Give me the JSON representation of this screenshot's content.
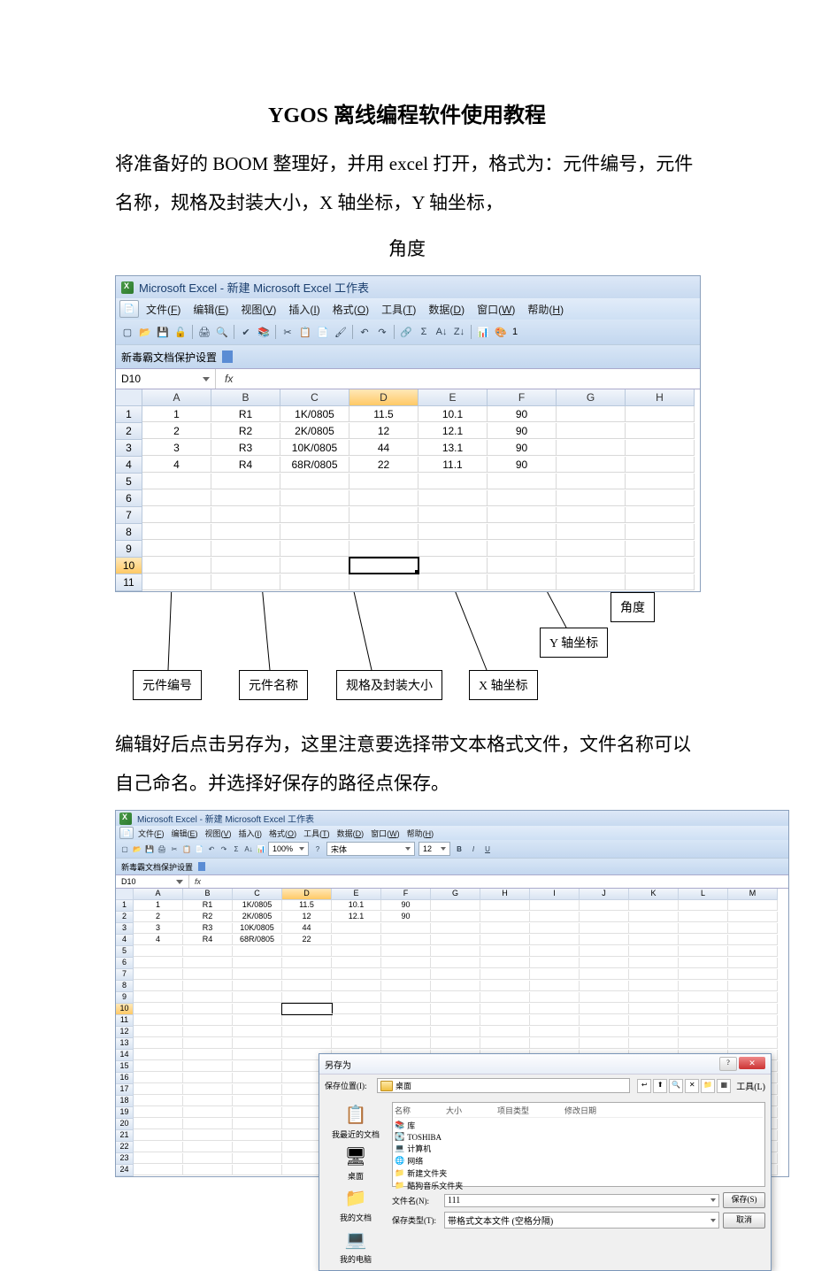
{
  "doc": {
    "title": "YGOS 离线编程软件使用教程",
    "p1": "将准备好的 BOOM 整理好，并用 excel 打开，格式为：元件编号，元件名称，规格及封装大小，X 轴坐标，Y 轴坐标，",
    "p1b": "角度",
    "p2": "编辑好后点击另存为，这里注意要选择带文本格式文件，文件名称可以自己命名。并选择好保存的路径点保存。"
  },
  "excel1": {
    "title": "Microsoft Excel - 新建 Microsoft Excel 工作表",
    "menus": [
      {
        "label": "文件",
        "key": "F"
      },
      {
        "label": "编辑",
        "key": "E"
      },
      {
        "label": "视图",
        "key": "V"
      },
      {
        "label": "插入",
        "key": "I"
      },
      {
        "label": "格式",
        "key": "O"
      },
      {
        "label": "工具",
        "key": "T"
      },
      {
        "label": "数据",
        "key": "D"
      },
      {
        "label": "窗口",
        "key": "W"
      },
      {
        "label": "帮助",
        "key": "H"
      }
    ],
    "protect": "新毒霸文档保护设置",
    "name_box": "D10",
    "columns": [
      "A",
      "B",
      "C",
      "D",
      "E",
      "F",
      "G",
      "H"
    ],
    "rows": [
      [
        "1",
        "R1",
        "1K/0805",
        "11.5",
        "10.1",
        "90",
        "",
        ""
      ],
      [
        "2",
        "R2",
        "2K/0805",
        "12",
        "12.1",
        "90",
        "",
        ""
      ],
      [
        "3",
        "R3",
        "10K/0805",
        "44",
        "13.1",
        "90",
        "",
        ""
      ],
      [
        "4",
        "R4",
        "68R/0805",
        "22",
        "11.1",
        "90",
        "",
        ""
      ],
      [
        "",
        "",
        "",
        "",
        "",
        "",
        "",
        ""
      ],
      [
        "",
        "",
        "",
        "",
        "",
        "",
        "",
        ""
      ],
      [
        "",
        "",
        "",
        "",
        "",
        "",
        "",
        ""
      ],
      [
        "",
        "",
        "",
        "",
        "",
        "",
        "",
        ""
      ],
      [
        "",
        "",
        "",
        "",
        "",
        "",
        "",
        ""
      ],
      [
        "",
        "",
        "",
        "",
        "",
        "",
        "",
        ""
      ],
      [
        "",
        "",
        "",
        "",
        "",
        "",
        "",
        ""
      ]
    ],
    "active_row": 10,
    "active_col": "D"
  },
  "labels": {
    "l1": "元件编号",
    "l2": "元件名称",
    "l3": "规格及封装大小",
    "l4": "X 轴坐标",
    "l5": "Y 轴坐标",
    "l6": "角度"
  },
  "excel2": {
    "title": "Microsoft Excel - 新建 Microsoft Excel 工作表",
    "zoom": "100%",
    "font": "宋体",
    "font_size": "12",
    "name_box": "D10",
    "columns": [
      "A",
      "B",
      "C",
      "D",
      "E",
      "F",
      "G",
      "H",
      "I",
      "J",
      "K",
      "L",
      "M"
    ],
    "rows": [
      [
        "1",
        "R1",
        "1K/0805",
        "11.5",
        "10.1",
        "90",
        "",
        "",
        "",
        "",
        "",
        "",
        ""
      ],
      [
        "2",
        "R2",
        "2K/0805",
        "12",
        "12.1",
        "90",
        "",
        "",
        "",
        "",
        "",
        "",
        ""
      ],
      [
        "3",
        "R3",
        "10K/0805",
        "44",
        "",
        "",
        "",
        "",
        "",
        "",
        "",
        "",
        ""
      ],
      [
        "4",
        "R4",
        "68R/0805",
        "22",
        "",
        "",
        "",
        "",
        "",
        "",
        "",
        "",
        ""
      ]
    ],
    "blank_rows": 20
  },
  "dialog": {
    "title": "另存为",
    "loc_label": "保存位置(I):",
    "loc_value": "桌面",
    "tools_label": "工具(L)",
    "headers": {
      "name": "名称",
      "size": "大小",
      "type": "项目类型",
      "date": "修改日期"
    },
    "items": [
      {
        "icon": "lib",
        "label": "库"
      },
      {
        "icon": "drive",
        "label": "TOSHIBA"
      },
      {
        "icon": "pc",
        "label": "计算机"
      },
      {
        "icon": "net",
        "label": "网络"
      },
      {
        "icon": "fldr",
        "label": "新建文件夹"
      },
      {
        "icon": "fldr",
        "label": "酷狗音乐文件夹"
      }
    ],
    "side": [
      {
        "icon": "📋",
        "label": "我最近的文档"
      },
      {
        "icon": "🖥",
        "label": "桌面"
      },
      {
        "icon": "📁",
        "label": "我的文档"
      },
      {
        "icon": "💻",
        "label": "我的电脑"
      }
    ],
    "fn_label": "文件名(N):",
    "fn_value": "111",
    "ft_label": "保存类型(T):",
    "ft_value": "带格式文本文件 (空格分隔)",
    "save": "保存(S)",
    "cancel": "取消"
  }
}
